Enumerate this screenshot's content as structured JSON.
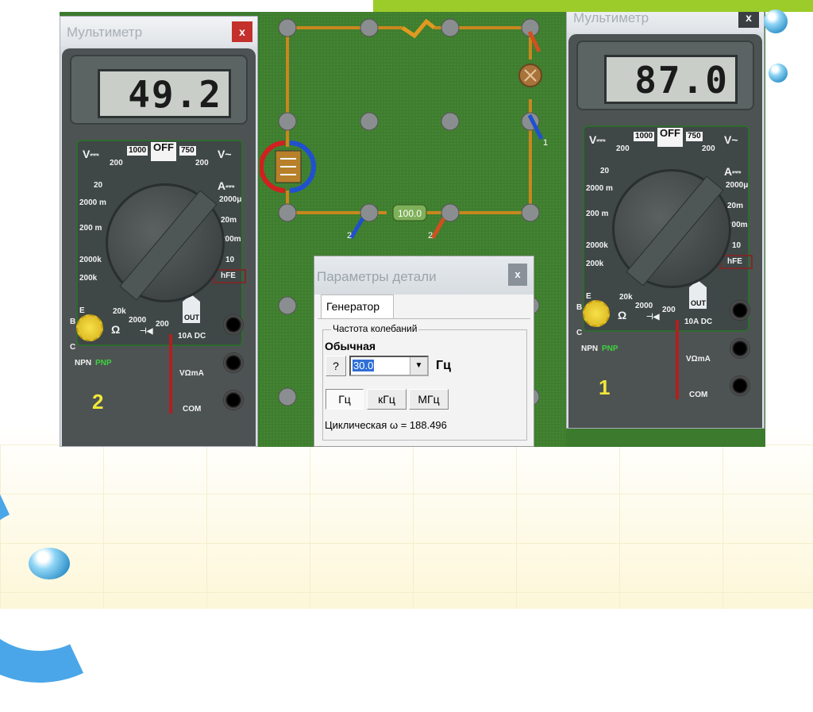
{
  "meters": [
    {
      "title": "Мультиметр",
      "close": "x",
      "reading": "49.2",
      "number": "2"
    },
    {
      "title": "Мультиметр",
      "close": "x",
      "reading": "87.0",
      "number": "1"
    }
  ],
  "meter_labels": {
    "vdc": "V⎓",
    "v1000": "1000",
    "off": "OFF",
    "v750": "750",
    "vac": "V~",
    "v200": "200",
    "vac200": "200",
    "v20": "20",
    "v2000m": "2000 m",
    "v200m": "200 m",
    "r2000k": "2000k",
    "r200k": "200k",
    "r20k": "20k",
    "r2000": "2000",
    "r200": "200",
    "ohm": "Ω",
    "diode": "⊣◀",
    "adc": "A⎓",
    "a2000u": "2000μ",
    "a20m": "20m",
    "a200m": "200m",
    "a10": "10",
    "hfe": "hFE",
    "out": "OUT",
    "a10dc": "10A DC",
    "vohm": "VΩmA",
    "com": "COM",
    "npn": "NPN",
    "pnp": "PNP",
    "e": "E",
    "b": "B",
    "c": "C"
  },
  "circuit": {
    "resistor_value": "100.0",
    "probe_labels": [
      "1",
      "2",
      "2"
    ]
  },
  "dialog": {
    "title": "Параметры детали",
    "close": "x",
    "tab": "Генератор",
    "group": "Частота колебаний",
    "mode": "Обычная",
    "help": "?",
    "frequency": "30.0",
    "unit": "Гц",
    "unit_buttons": [
      "Гц",
      "кГц",
      "МГц"
    ],
    "cyclic_label": "Циклическая",
    "omega": "ω = 188.496"
  },
  "colors": {
    "board": "#3f7d2f",
    "wire": "#c8871e",
    "accent": "#9ccc2a"
  }
}
